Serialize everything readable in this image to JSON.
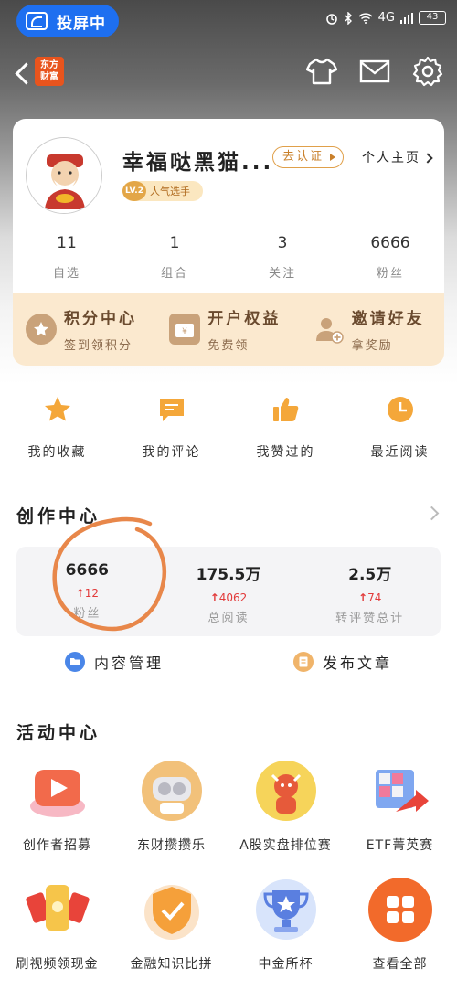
{
  "status_bar": {
    "cast_label": "投屏中",
    "network": "4G",
    "battery": "43"
  },
  "nav": {
    "logo_text_line1": "东方",
    "logo_text_line2": "财富"
  },
  "profile": {
    "username": "幸福哒黑猫...",
    "verify_label": "去认证",
    "homepage_label": "个人主页",
    "level": "LV.2",
    "level_title": "人气选手",
    "stats": [
      {
        "value": "11",
        "label": "自选"
      },
      {
        "value": "1",
        "label": "组合"
      },
      {
        "value": "3",
        "label": "关注"
      },
      {
        "value": "6666",
        "label": "粉丝"
      }
    ]
  },
  "perks": [
    {
      "title": "积分中心",
      "sub": "签到领积分"
    },
    {
      "title": "开户权益",
      "sub": "免费领"
    },
    {
      "title": "邀请好友",
      "sub": "拿奖励"
    }
  ],
  "quick_actions": [
    {
      "label": "我的收藏"
    },
    {
      "label": "我的评论"
    },
    {
      "label": "我赞过的"
    },
    {
      "label": "最近阅读"
    }
  ],
  "creator": {
    "title": "创作中心",
    "stats": [
      {
        "value": "6666",
        "delta": "12",
        "label": "粉丝"
      },
      {
        "value": "175.5万",
        "delta": "4062",
        "label": "总阅读"
      },
      {
        "value": "2.5万",
        "delta": "74",
        "label": "转评赞总计"
      }
    ],
    "links": [
      {
        "label": "内容管理"
      },
      {
        "label": "发布文章"
      }
    ]
  },
  "activity": {
    "title": "活动中心",
    "items": [
      {
        "label": "创作者招募"
      },
      {
        "label": "东财攒攒乐"
      },
      {
        "label": "A股实盘排位赛"
      },
      {
        "label": "ETF菁英赛"
      },
      {
        "label": "刷视频领现金"
      },
      {
        "label": "金融知识比拼"
      },
      {
        "label": "中金所杯"
      },
      {
        "label": "查看全部"
      }
    ]
  },
  "colors": {
    "accent_orange": "#e8541d",
    "cast_blue": "#1e6ff0",
    "perk_bg": "#fbe9cf",
    "delta_red": "#e23b3b",
    "annotation": "#e8874a"
  }
}
